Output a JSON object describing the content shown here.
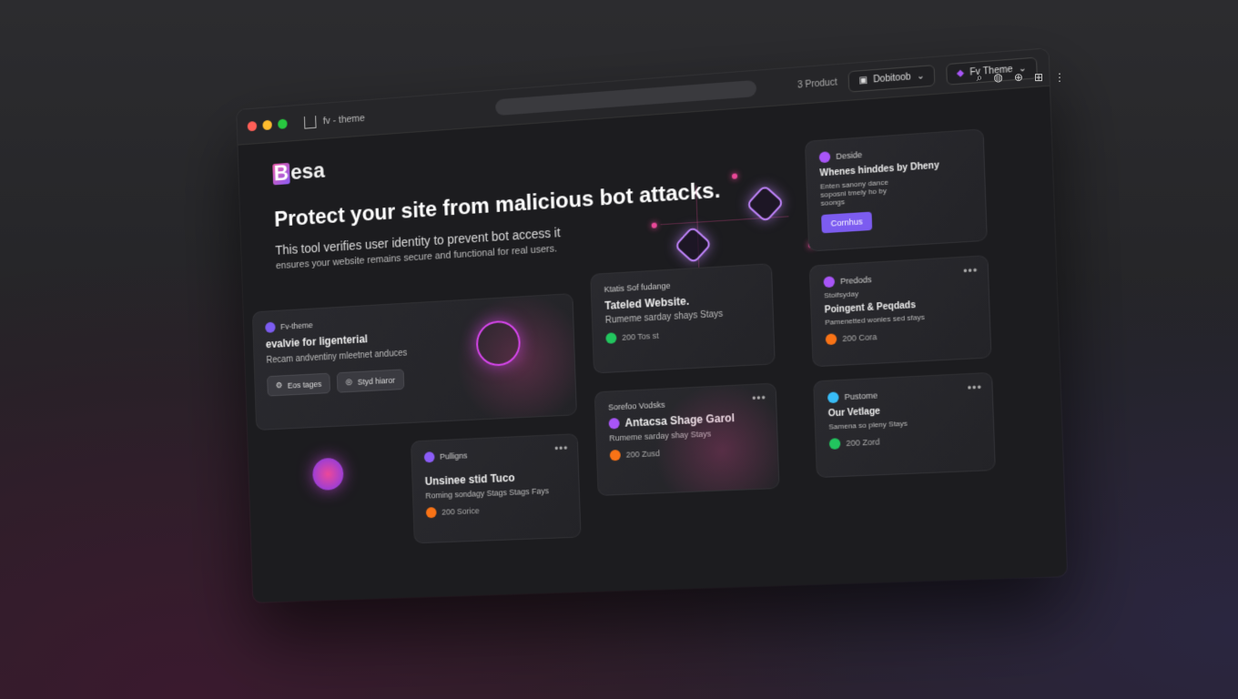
{
  "window": {
    "tab_title": "fv - theme",
    "toolbar": {
      "product_label": "3 Product",
      "select1_label": "Dobitoob",
      "select2_label": "Fv Theme"
    }
  },
  "brand": {
    "logo_letter": "B",
    "logo_rest": "esa"
  },
  "hero": {
    "title": "Protect your site from malicious bot attacks.",
    "subtitle": "This tool verifies user identity to prevent bot access it",
    "subtitle2": "ensures your website remains secure and functional for real users."
  },
  "cards": {
    "main": {
      "tag": "Fv-theme",
      "title": "evalvie for ligenterial",
      "desc": "Recam andventiny mleetnet anduces",
      "btn1": "Eos tages",
      "btn2": "Styd hiaror"
    },
    "card2": {
      "tag": "Ktatis Sof fudange",
      "title": "Tateled Website.",
      "desc": "Rumeme sarday shays Stays",
      "foot": "200 Tos st"
    },
    "card3": {
      "tag": "Deside",
      "title": "Whenes hinddes by Dheny",
      "desc": "Enten sanony dance soposni tmely ho by soongs",
      "btn": "Cornhus"
    },
    "card4": {
      "tag": "Predods",
      "sub": "Stoifsyday",
      "title": "Poingent & Peqdads",
      "desc": "Pamenetted wonies sed sfays",
      "foot": "200 Cora",
      "more": "•••"
    },
    "card5": {
      "tag": "Pulligns",
      "title": "Unsinee stid Tuco",
      "desc": "Roming sondagy Stags Stags Fays",
      "foot": "200 Sorice",
      "more": "•••"
    },
    "card6": {
      "tag": "Sorefoo Vodsks",
      "title": "Antacsa Shage Garol",
      "desc": "Rumeme sarday shay Stays",
      "foot": "200 Zusd",
      "more": "•••"
    },
    "card7": {
      "tag": "Pustome",
      "title": "Our Vetlage",
      "desc": "Samena so pleny Stays",
      "foot": "200 Zord",
      "more": "•••"
    }
  },
  "colors": {
    "accent_pink": "#ec4899",
    "accent_purple": "#8b5cf6",
    "bg": "#1c1c1f"
  }
}
